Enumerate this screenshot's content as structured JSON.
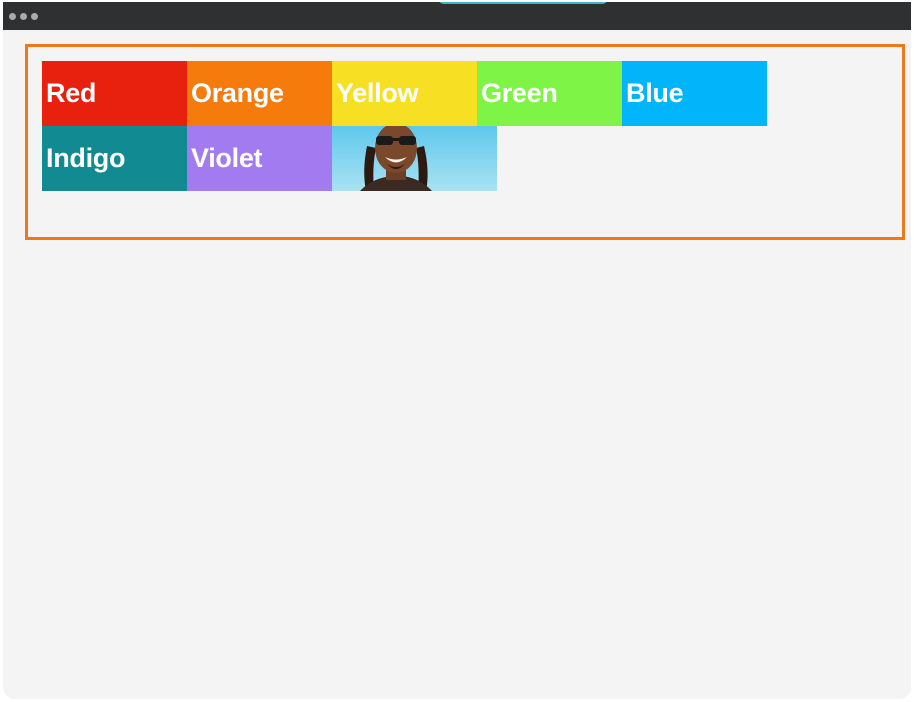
{
  "colors": {
    "accent_outline": "#ea7a1c",
    "titlebar": "#2f3032",
    "canvas": "#f4f4f4"
  },
  "boxes": [
    {
      "label": "Red",
      "color": "#e8210f"
    },
    {
      "label": "Orange",
      "color": "#f47b0c"
    },
    {
      "label": "Yellow",
      "color": "#f7e024"
    },
    {
      "label": "Green",
      "color": "#7ef546"
    },
    {
      "label": "Blue",
      "color": "#02b5fb"
    },
    {
      "label": "Indigo",
      "color": "#118b91"
    },
    {
      "label": "Violet",
      "color": "#a17bef"
    }
  ],
  "photo": {
    "icon": "person-sunglasses-photo"
  }
}
